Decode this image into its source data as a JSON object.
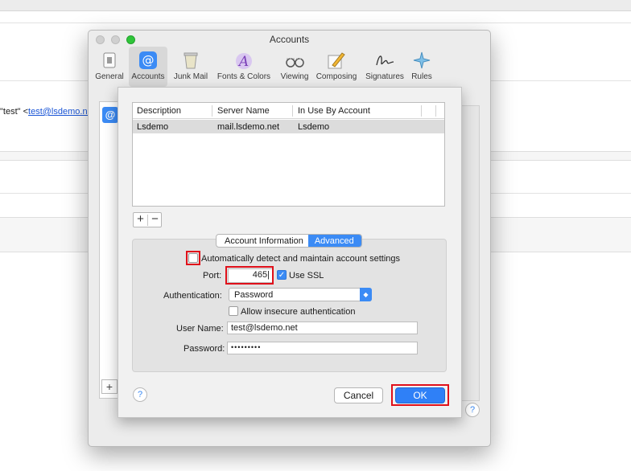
{
  "background": {
    "recipient_name": "\"test\" <",
    "recipient_email": "test@lsdemo.ne"
  },
  "window": {
    "title": "Accounts",
    "toolbar": [
      {
        "label": "General",
        "icon": "general-icon"
      },
      {
        "label": "Accounts",
        "icon": "at-icon"
      },
      {
        "label": "Junk Mail",
        "icon": "junk-mail-icon"
      },
      {
        "label": "Fonts & Colors",
        "icon": "fonts-colors-icon"
      },
      {
        "label": "Viewing",
        "icon": "glasses-icon"
      },
      {
        "label": "Composing",
        "icon": "pencil-icon"
      },
      {
        "label": "Signatures",
        "icon": "signature-icon"
      },
      {
        "label": "Rules",
        "icon": "rules-icon"
      }
    ]
  },
  "smtp_table": {
    "columns": [
      "Description",
      "Server Name",
      "In Use By Account"
    ],
    "rows": [
      [
        "Lsdemo",
        "mail.lsdemo.net",
        "Lsdemo"
      ]
    ]
  },
  "tabs": {
    "account_information": "Account Information",
    "advanced": "Advanced"
  },
  "advanced": {
    "auto_detect_label": "Automatically detect and maintain account settings",
    "auto_detect_checked": false,
    "port_label": "Port:",
    "port_value": "465",
    "use_ssl_label": "Use SSL",
    "use_ssl_checked": true,
    "auth_label": "Authentication:",
    "auth_value": "Password",
    "insecure_label": "Allow insecure authentication",
    "insecure_checked": false,
    "username_label": "User Name:",
    "username_value": "test@lsdemo.net",
    "password_label": "Password:",
    "password_value": "•••••••••"
  },
  "buttons": {
    "help": "?",
    "cancel": "Cancel",
    "ok": "OK",
    "add": "+",
    "remove": "−"
  },
  "colors": {
    "accent": "#3b8bf5",
    "highlight": "#e0101a"
  }
}
